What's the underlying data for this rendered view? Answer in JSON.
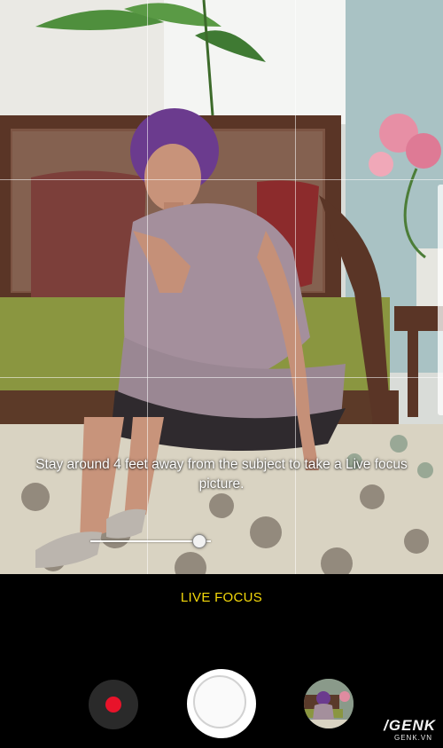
{
  "viewfinder": {
    "hint": "Stay around 4 feet away from the subject to take a Live focus picture.",
    "blur_level": 0.9
  },
  "controls": {
    "mode_label": "LIVE FOCUS"
  },
  "watermark": {
    "logo": "/GENK",
    "site": "GENK.VN"
  },
  "colors": {
    "mode_label": "#f5d90a",
    "record_dot": "#e8132a"
  },
  "icons": {
    "record": "record-dot-icon",
    "shutter": "shutter-circle",
    "gallery": "gallery-thumbnail"
  }
}
